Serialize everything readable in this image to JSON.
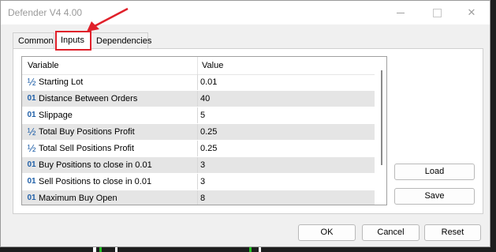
{
  "window": {
    "title": "Defender V4 4.00",
    "controls": {
      "minimize_icon": "minimize-icon",
      "maximize_icon": "maximize-icon",
      "close_icon": "close-icon",
      "close_glyph": "✕"
    }
  },
  "tabs": [
    {
      "label": "Common",
      "active": false
    },
    {
      "label": "Inputs",
      "active": true
    },
    {
      "label": "Dependencies",
      "active": false
    }
  ],
  "annotation": {
    "color": "#e0202a"
  },
  "table": {
    "columns": [
      "Variable",
      "Value"
    ],
    "rows": [
      {
        "type_icon": "½",
        "name": "Starting Lot",
        "value": "0.01"
      },
      {
        "type_icon": "01",
        "name": "Distance Between Orders",
        "value": "40"
      },
      {
        "type_icon": "01",
        "name": "Slippage",
        "value": "5"
      },
      {
        "type_icon": "½",
        "name": "Total Buy Positions Profit",
        "value": "0.25"
      },
      {
        "type_icon": "½",
        "name": "Total Sell Positions Profit",
        "value": "0.25"
      },
      {
        "type_icon": "01",
        "name": "Buy Positions to close in 0.01",
        "value": "3"
      },
      {
        "type_icon": "01",
        "name": "Sell Positions to close in 0.01",
        "value": "3"
      },
      {
        "type_icon": "01",
        "name": "Maximum Buy Open",
        "value": "8"
      }
    ]
  },
  "side_buttons": {
    "load": "Load",
    "save": "Save"
  },
  "footer_buttons": {
    "ok": "OK",
    "cancel": "Cancel",
    "reset": "Reset"
  }
}
